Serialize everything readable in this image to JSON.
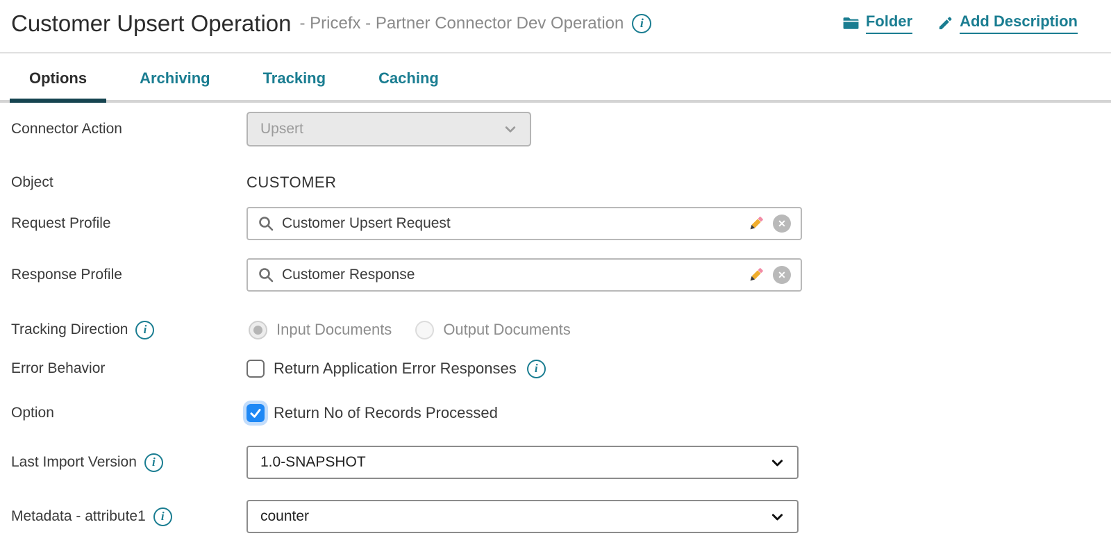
{
  "header": {
    "title": "Customer Upsert Operation",
    "subtitle": "- Pricefx - Partner Connector Dev Operation",
    "folder_link": "Folder",
    "add_description_link": "Add Description"
  },
  "tabs": [
    {
      "label": "Options",
      "active": true
    },
    {
      "label": "Archiving",
      "active": false
    },
    {
      "label": "Tracking",
      "active": false
    },
    {
      "label": "Caching",
      "active": false
    }
  ],
  "form": {
    "connector_action": {
      "label": "Connector Action",
      "value": "Upsert",
      "disabled": true
    },
    "object": {
      "label": "Object",
      "value": "CUSTOMER"
    },
    "request_profile": {
      "label": "Request Profile",
      "value": "Customer Upsert Request"
    },
    "response_profile": {
      "label": "Response Profile",
      "value": "Customer Response"
    },
    "tracking_direction": {
      "label": "Tracking Direction",
      "options": [
        {
          "label": "Input Documents",
          "selected": true
        },
        {
          "label": "Output Documents",
          "selected": false
        }
      ]
    },
    "error_behavior": {
      "label": "Error Behavior",
      "checkbox_label": "Return Application Error Responses",
      "checked": false
    },
    "option": {
      "label": "Option",
      "checkbox_label": "Return No of Records Processed",
      "checked": true
    },
    "last_import_version": {
      "label": "Last Import Version",
      "value": "1.0-SNAPSHOT"
    },
    "metadata_attribute1": {
      "label": "Metadata - attribute1",
      "value": "counter"
    }
  },
  "icons": {
    "info": "circled-italic-i",
    "folder": "folder",
    "edit": "pencil",
    "search": "magnifier",
    "clear": "circled-x",
    "dropdown": "chevron-down"
  },
  "colors": {
    "teal": "#1a7d91",
    "tab_dark": "#164450",
    "blue": "#1e88f5"
  }
}
